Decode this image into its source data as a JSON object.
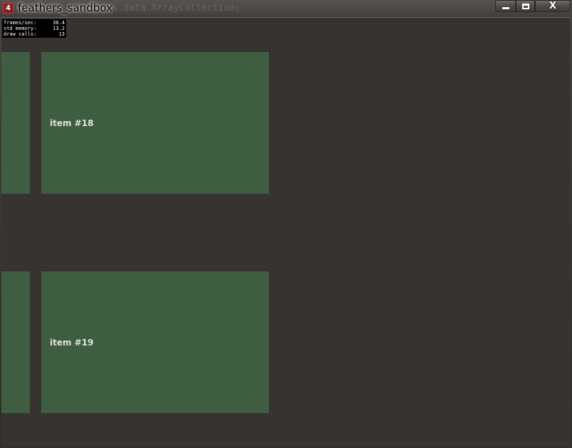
{
  "window": {
    "title": "feathers_sandbox",
    "background_ghost_text": "rs.data.ArrayCollection;",
    "icon": "flash-app-icon",
    "controls": {
      "minimize_icon": "minimize-icon",
      "maximize_icon": "maximize-icon",
      "close_glyph": "X"
    }
  },
  "stats": {
    "rows": [
      {
        "label": "frames/sec:",
        "value": "30.4"
      },
      {
        "label": "std memory:",
        "value": "13.2"
      },
      {
        "label": "draw calls:",
        "value": "13"
      }
    ]
  },
  "list": {
    "items": [
      {
        "label": "item #18"
      },
      {
        "label": "item #19"
      }
    ]
  },
  "colors": {
    "client_background": "#363330",
    "item_background": "#3f5e41",
    "item_text": "#e2e4dc"
  }
}
